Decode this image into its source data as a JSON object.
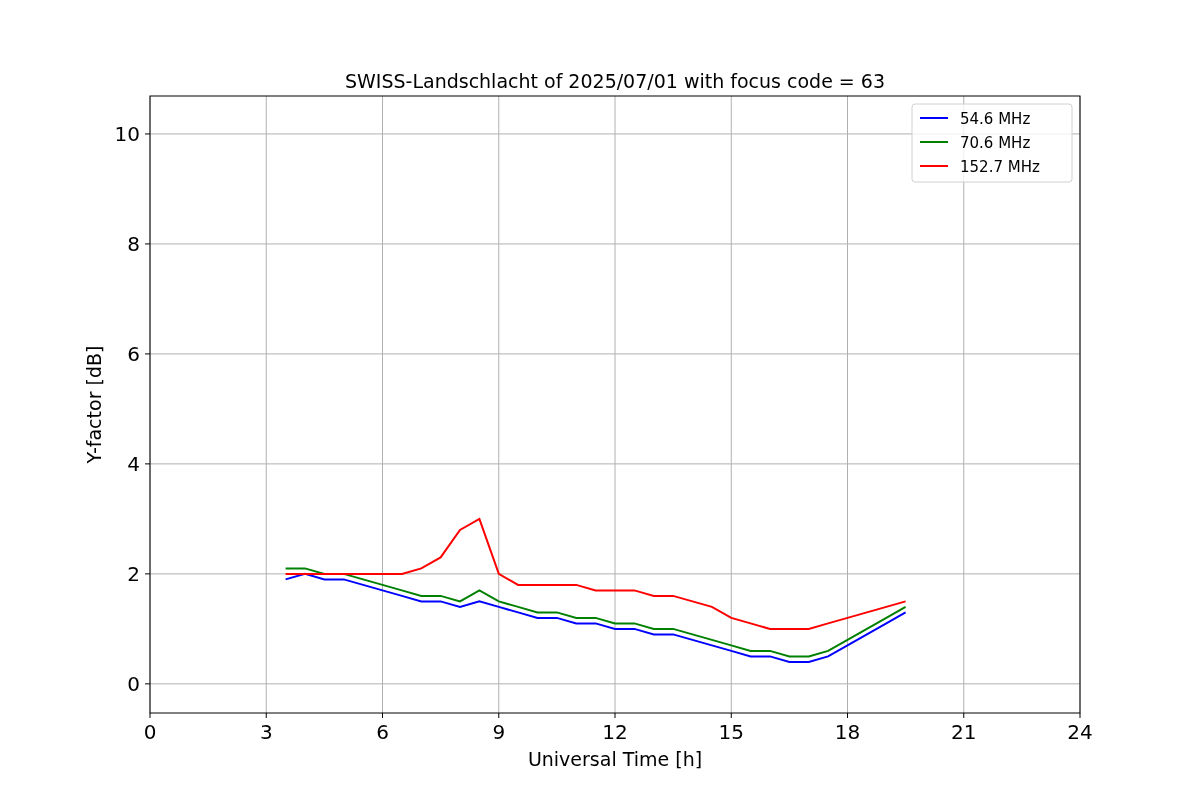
{
  "figure": {
    "chart_data": {
      "type": "line",
      "title": "SWISS-Landschlacht of 2025/07/01 with focus code = 63",
      "xlabel": "Universal Time [h]",
      "ylabel": "Y-factor [dB]",
      "x": [
        3.5,
        4,
        4.5,
        5,
        5.5,
        6,
        6.5,
        7,
        7.5,
        8,
        8.5,
        9,
        9.5,
        10,
        10.5,
        11,
        11.5,
        12,
        12.5,
        13,
        13.5,
        14,
        14.5,
        15,
        15.5,
        16,
        16.5,
        17,
        17.5,
        18,
        18.5,
        19,
        19.5
      ],
      "series": [
        {
          "name": "54.6 MHz",
          "color": "#0000ff",
          "values": [
            1.9,
            2.0,
            1.9,
            1.9,
            1.8,
            1.7,
            1.6,
            1.5,
            1.5,
            1.4,
            1.5,
            1.4,
            1.3,
            1.2,
            1.2,
            1.1,
            1.1,
            1.0,
            1.0,
            0.9,
            0.9,
            0.8,
            0.7,
            0.6,
            0.5,
            0.5,
            0.4,
            0.4,
            0.5,
            0.7,
            0.9,
            1.1,
            1.3
          ]
        },
        {
          "name": "70.6 MHz",
          "color": "#008000",
          "values": [
            2.1,
            2.1,
            2.0,
            2.0,
            1.9,
            1.8,
            1.7,
            1.6,
            1.6,
            1.5,
            1.7,
            1.5,
            1.4,
            1.3,
            1.3,
            1.2,
            1.2,
            1.1,
            1.1,
            1.0,
            1.0,
            0.9,
            0.8,
            0.7,
            0.6,
            0.6,
            0.5,
            0.5,
            0.6,
            0.8,
            1.0,
            1.2,
            1.4
          ]
        },
        {
          "name": "152.7 MHz",
          "color": "#ff0000",
          "values": [
            2.0,
            2.0,
            2.0,
            2.0,
            2.0,
            2.0,
            2.0,
            2.1,
            2.3,
            2.8,
            3.0,
            2.0,
            1.8,
            1.8,
            1.8,
            1.8,
            1.7,
            1.7,
            1.7,
            1.6,
            1.6,
            1.5,
            1.4,
            1.2,
            1.1,
            1.0,
            1.0,
            1.0,
            1.1,
            1.2,
            1.3,
            1.4,
            1.5
          ]
        }
      ],
      "grid": true,
      "legend": true,
      "xlim": [
        0,
        24
      ],
      "ylim": [
        -0.53,
        10.69
      ],
      "xticks": [
        0,
        3,
        6,
        9,
        12,
        15,
        18,
        21,
        24
      ],
      "yticks": [
        0,
        2,
        4,
        6,
        8,
        10
      ]
    }
  }
}
